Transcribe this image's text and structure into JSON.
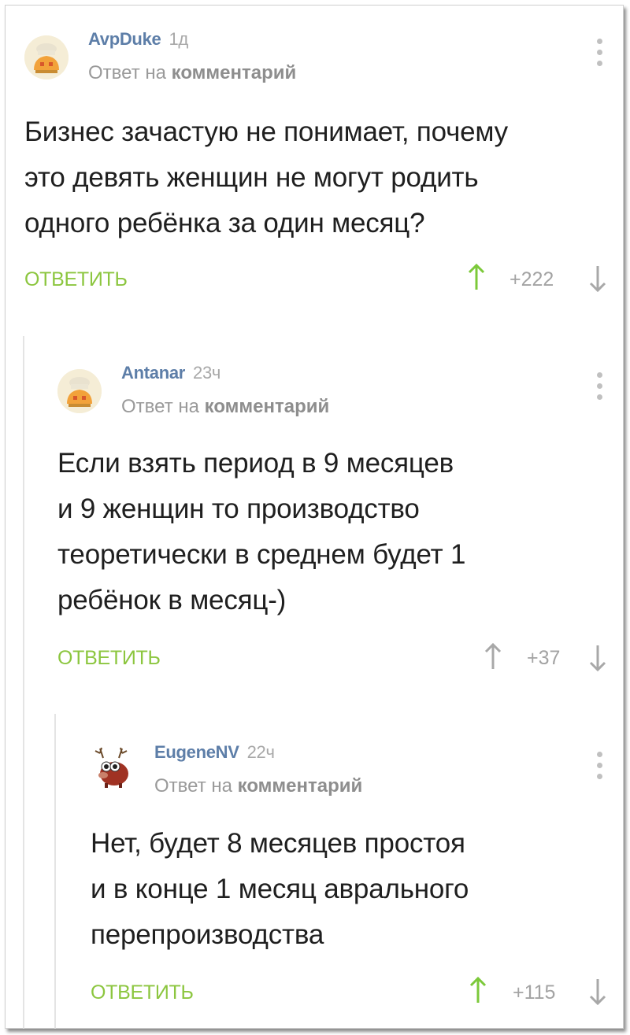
{
  "colors": {
    "username": "#5d7ea8",
    "accent_green": "#8cc63f",
    "muted": "#a3a3a3",
    "text": "#1f1f1f"
  },
  "comments": [
    {
      "author": "AvpDuke",
      "time": "1д",
      "reply_prefix": "Ответ на",
      "reply_link": "комментарий",
      "avatar_icon": "default-chef-avatar-icon",
      "lines": [
        "Бизнес зачастую не понимает, почему",
        "это девять женщин не могут родить",
        "одного ребёнка за один месяц?"
      ],
      "reply_label": "ОТВЕТИТЬ",
      "score": "+222",
      "upvoted": true
    },
    {
      "author": "Antanar",
      "time": "23ч",
      "reply_prefix": "Ответ на",
      "reply_link": "комментарий",
      "avatar_icon": "default-chef-avatar-icon",
      "lines": [
        "Если взять период в 9 месяцев",
        "и 9 женщин то производство",
        "теоретически в среднем будет 1",
        "ребёнок в месяц-)"
      ],
      "reply_label": "ОТВЕТИТЬ",
      "score": "+37",
      "upvoted": false
    },
    {
      "author": "EugeneNV",
      "time": "22ч",
      "reply_prefix": "Ответ на",
      "reply_link": "комментарий",
      "avatar_icon": "reindeer-avatar-icon",
      "lines": [
        "Нет, будет 8 месяцев простоя",
        "и в конце 1 месяц аврального",
        "перепроизводства"
      ],
      "reply_label": "ОТВЕТИТЬ",
      "score": "+115",
      "upvoted": true
    }
  ]
}
